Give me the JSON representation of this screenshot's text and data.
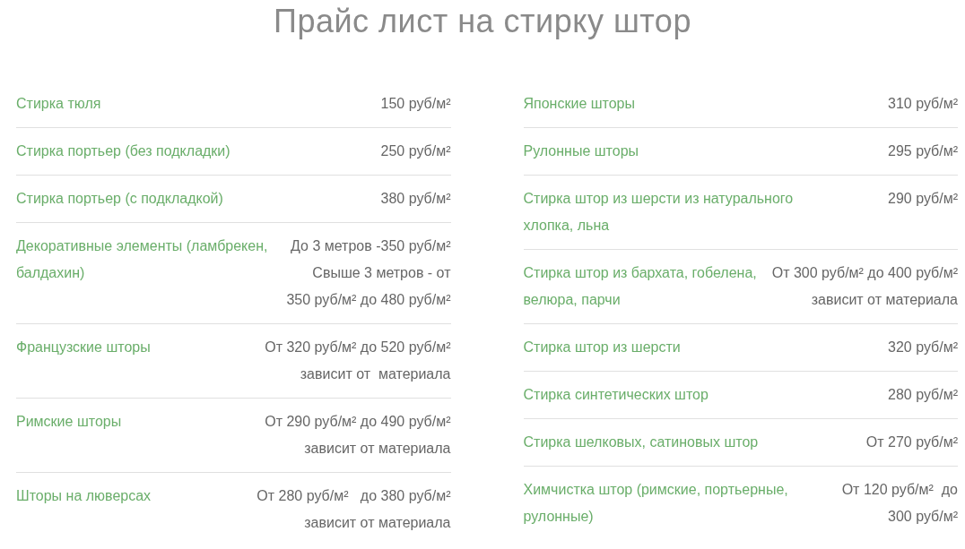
{
  "title": "Прайс лист на стирку штор",
  "columns": [
    {
      "rows": [
        {
          "name": "Стирка тюля",
          "price": [
            "150 руб/м²"
          ]
        },
        {
          "name": "Стирка портьер (без подкладки)",
          "price": [
            "250 руб/м²"
          ]
        },
        {
          "name": "Стирка портьер (с подкладкой)",
          "price": [
            "380 руб/м²"
          ]
        },
        {
          "name": "Декоративные элементы (ламбрекен, балдахин)",
          "price": [
            "До 3 метров -350 руб/м²",
            "Свыше 3 метров - от",
            "350 руб/м² до 480 руб/м²"
          ]
        },
        {
          "name": "Французские шторы",
          "price": [
            "От 320 руб/м² до 520 руб/м²",
            "зависит от  материала"
          ]
        },
        {
          "name": "Римские шторы",
          "price": [
            "От 290 руб/м² до 490 руб/м²",
            "зависит от материала"
          ]
        },
        {
          "name": "Шторы на люверсах",
          "price": [
            "От 280 руб/м²   до 380 руб/м²",
            "зависит от материала"
          ]
        }
      ]
    },
    {
      "rows": [
        {
          "name": "Японские шторы",
          "price": [
            "310 руб/м²"
          ]
        },
        {
          "name": "Рулонные шторы",
          "price": [
            "295 руб/м²"
          ]
        },
        {
          "name": "Стирка штор из шерсти из натурального хлопка, льна",
          "price": [
            "290 руб/м²"
          ]
        },
        {
          "name": "Стирка штор из бархата, гобелена, велюра, парчи",
          "price": [
            "От 300 руб/м² до 400 руб/м²",
            "зависит от материала"
          ]
        },
        {
          "name": "Стирка штор из шерсти",
          "price": [
            "320 руб/м²"
          ]
        },
        {
          "name": "Стирка синтетических штор",
          "price": [
            "280 руб/м²"
          ]
        },
        {
          "name": "Стирка шелковых, сатиновых штор",
          "price": [
            "От 270 руб/м²"
          ]
        },
        {
          "name": "Химчистка штор (римские, портьерные, рулонные)",
          "price": [
            "От 120 руб/м²  до",
            "300 руб/м²"
          ]
        }
      ]
    }
  ]
}
